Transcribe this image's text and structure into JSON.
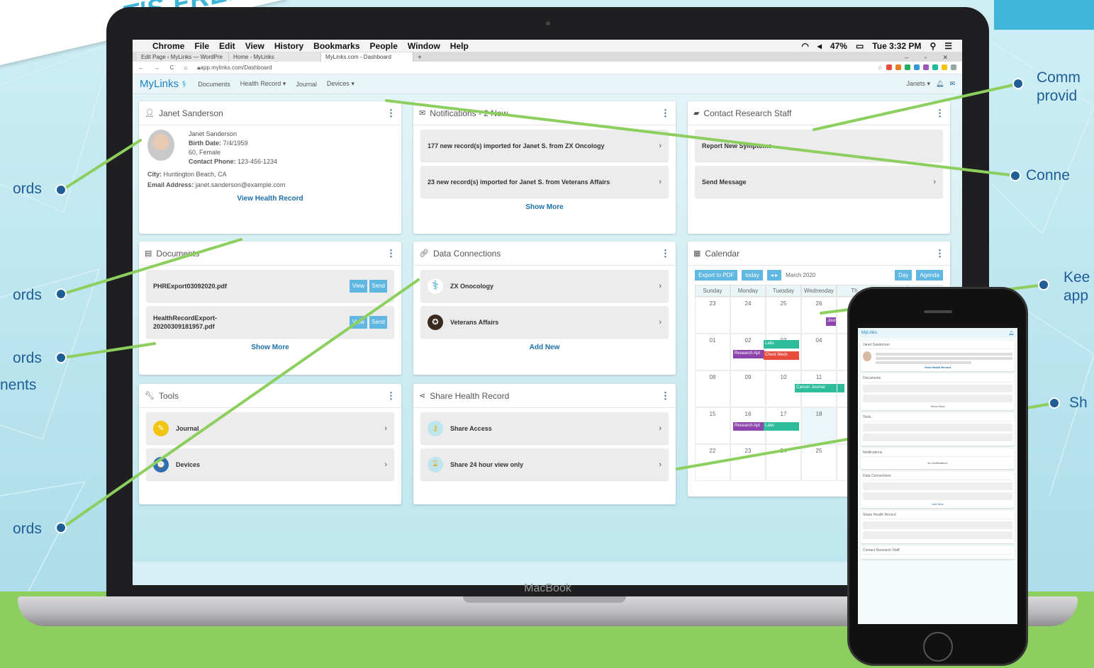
{
  "promo": {
    "ribbon_text": "T'S FREE!"
  },
  "callouts": {
    "right_1_line1": "Comm",
    "right_1_line2": "provid",
    "right_2": "Conne",
    "right_3_line1": "Kee",
    "right_3_line2": "app",
    "right_4": "Sh",
    "left_1": "ords",
    "left_2": "ords",
    "left_3_line1": "ords",
    "left_3_line2": "nents",
    "left_4": "ords"
  },
  "menubar": {
    "app": "Chrome",
    "items": [
      "File",
      "Edit",
      "View",
      "History",
      "Bookmarks",
      "People",
      "Window",
      "Help"
    ],
    "battery": "47%",
    "clock": "Tue 3:32 PM"
  },
  "browser": {
    "tabs": [
      "Edit Page ‹ MyLinks — WordPre",
      "Home - MyLinks",
      "MyLinks.com - Dashboard"
    ],
    "url": "app.mylinks.com/Dashboard",
    "new_tab": "+"
  },
  "appnav": {
    "logo": "MyLinks",
    "items": [
      "Documents",
      "Health Record ▾",
      "Journal",
      "Devices ▾"
    ],
    "user": "Janets ▾"
  },
  "profile": {
    "title": "Janet Sanderson",
    "name": "Janet Sanderson",
    "birth_label": "Birth Date:",
    "birth": "7/4/1959",
    "age_sex": "60, Female",
    "phone_label": "Contact Phone:",
    "phone": "123-456-1234",
    "city_label": "City:",
    "city": "Huntington Beach, CA",
    "email_label": "Email Address:",
    "email": "janet.sanderson@example.com",
    "link": "View Health Record"
  },
  "notifications": {
    "title": "Notifications - 2 New",
    "items": [
      "177 new record(s) imported for Janet S. from ZX Oncology",
      "23 new record(s) imported for Janet S. from Veterans Affairs"
    ],
    "more": "Show More"
  },
  "contact": {
    "title": "Contact Research Staff",
    "items": [
      "Report New Symptoms",
      "Send Message"
    ]
  },
  "documents": {
    "title": "Documents",
    "files": [
      "PHRExport03092020.pdf",
      "HealthRecordExport-20200309181957.pdf"
    ],
    "file2_line1": "HealthRecordExport-",
    "file2_line2": "20200309181957.pdf",
    "view": "View",
    "send": "Send",
    "more": "Show More"
  },
  "connections": {
    "title": "Data Connections",
    "items": [
      "ZX Onocology",
      "Veterans Affairs"
    ],
    "add": "Add New"
  },
  "calendar": {
    "title": "Calendar",
    "export": "Export to PDF",
    "today": "today",
    "month": "March 2020",
    "days": [
      "Sunday",
      "Monday",
      "Tuesday",
      "Wednesday",
      "Th"
    ],
    "dates": [
      "23",
      "24",
      "25",
      "26",
      "01",
      "02",
      "03",
      "04",
      "08",
      "09",
      "10",
      "11",
      "15",
      "16",
      "17",
      "18",
      "22",
      "23",
      "24",
      "25"
    ],
    "events": [
      "Research Apt",
      "Labs",
      "Chest Meds",
      "Cancer Journal",
      "Research Apt",
      "Labs",
      "Journal"
    ],
    "view_buttons": [
      "Day",
      "Agenda"
    ]
  },
  "tools": {
    "title": "Tools",
    "items": [
      "Journal",
      "Devices"
    ]
  },
  "share": {
    "title": "Share Health Record",
    "items": [
      "Share Access",
      "Share 24 hour view only"
    ]
  },
  "laptop": {
    "brand": "MacBook"
  },
  "phone": {
    "logo": "MyLinks",
    "sections": [
      "Janet Sanderson",
      "Documents",
      "Tools",
      "Notifications",
      "Data Connections",
      "Share Health Record",
      "Contact Research Staff"
    ],
    "no_notifications": "No Notifications",
    "view_health_record": "View Health Record",
    "show_more": "Show More",
    "add_new": "Add New"
  },
  "colors": {
    "brand_blue": "#1b82c4",
    "accent_teal": "#3fb6d8",
    "callout_text": "#1f5d96",
    "leader_green": "#8ccf5e",
    "button_blue": "#5fb7e2"
  }
}
